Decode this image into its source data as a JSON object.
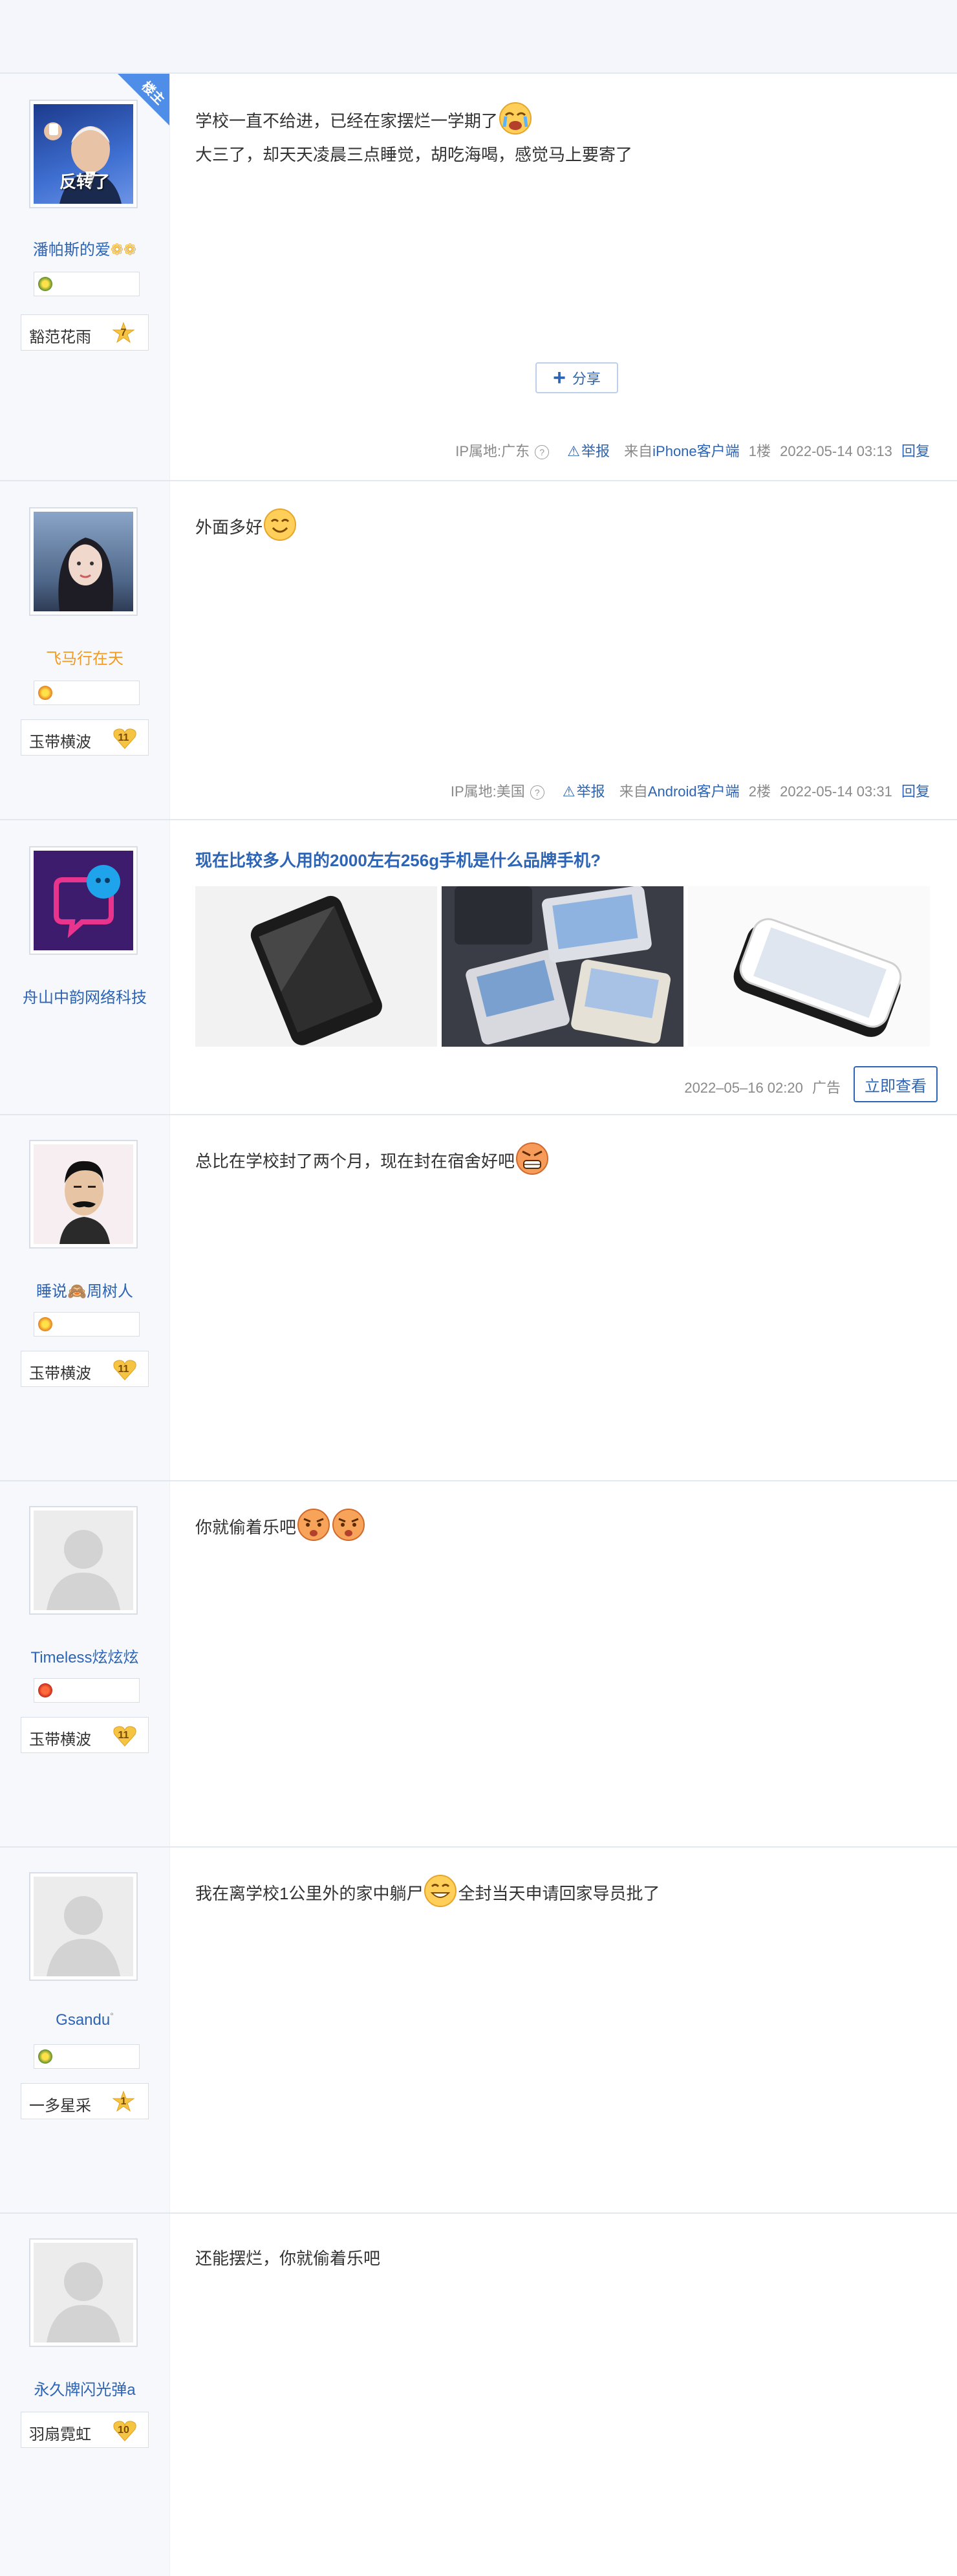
{
  "posts": [
    {
      "username": "潘帕斯的爱",
      "avatar_caption": "反转了",
      "corner_tag": "楼主",
      "level_name": "豁范花雨",
      "level_num": "7",
      "lines": [
        "学校一直不给进，已经在家摆烂一学期了",
        "大三了，却天天凌晨三点睡觉，胡吃海喝，感觉马上要寄了"
      ],
      "share_label": "分享",
      "footer": {
        "ip": "IP属地:广东",
        "report": "举报",
        "from_prefix": "来自",
        "client": "iPhone客户端",
        "floor": "1楼",
        "time": "2022-05-14 03:13",
        "reply": "回复"
      }
    },
    {
      "username": "飞马行在天",
      "level_name": "玉带横波",
      "level_num": "11",
      "lines": [
        "外面多好"
      ],
      "footer": {
        "ip": "IP属地:美国",
        "report": "举报",
        "from_prefix": "来自",
        "client": "Android客户端",
        "floor": "2楼",
        "time": "2022-05-14 03:31",
        "reply": "回复"
      }
    },
    {
      "username": "睡说",
      "username_suffix": "周树人",
      "level_name": "玉带横波",
      "level_num": "11",
      "lines": [
        "总比在学校封了两个月，现在封在宿舍好吧"
      ]
    },
    {
      "username": "Timeless炫炫炫",
      "level_name": "玉带横波",
      "level_num": "11",
      "lines": [
        "你就偷着乐吧"
      ]
    },
    {
      "username": "Gsandu",
      "level_name": "一多星采",
      "level_num": "1",
      "lines_a": "我在离学校1公里外的家中躺尸",
      "lines_b": "全封当天申请回家导员批了"
    },
    {
      "username": "永久牌闪光弹a",
      "level_name": "羽扇霓虹",
      "level_num": "10",
      "lines": [
        "还能摆烂，你就偷着乐吧"
      ]
    }
  ],
  "ad": {
    "advertiser": "舟山中韵网络科技",
    "title": "现在比较多人用的2000左右256g手机是什么品牌手机?",
    "date": "2022–05–16 02:20",
    "ad_label": "广告",
    "cta": "立即查看"
  },
  "colors": {
    "link": "#2d64b3",
    "accent_orange": "#f39a23",
    "tag_blue": "#4f8ee8"
  }
}
